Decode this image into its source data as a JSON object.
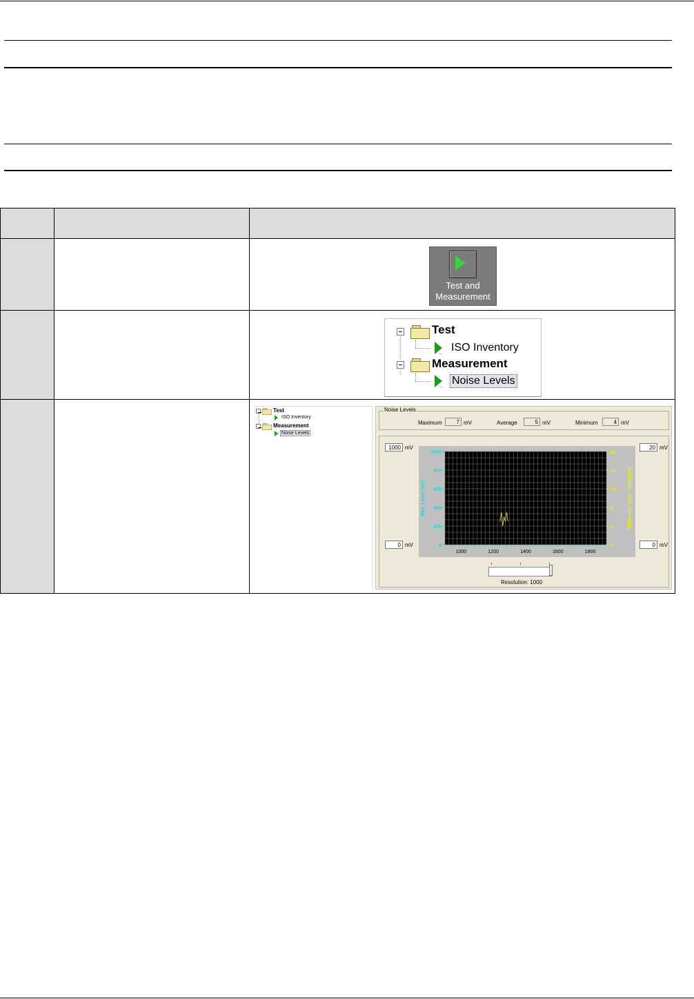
{
  "table": {
    "rows": [
      {
        "step": "",
        "action": "",
        "image": "test-and-measurement-button"
      },
      {
        "step": "",
        "action": "",
        "image": "tree-view"
      },
      {
        "step": "",
        "action": "",
        "image": "noise-levels-screen"
      }
    ]
  },
  "button": {
    "label_line1": "Test and",
    "label_line2": "Measurement",
    "icon": "green-play-icon"
  },
  "tree": {
    "test": "Test",
    "iso_inventory": "ISO Inventory",
    "measurement": "Measurement",
    "noise_levels": "Noise Levels"
  },
  "noise_panel": {
    "group_title": "Noise Levels",
    "maximum_label": "Maximum",
    "maximum_value": "7",
    "average_label": "Average",
    "average_value": "5",
    "minimum_label": "Minimum",
    "minimum_value": "4",
    "unit": "mV",
    "left_top_value": "1000",
    "left_bottom_value": "0",
    "right_top_value": "20",
    "right_bottom_value": "0",
    "resolution_label": "Resolution: 1000"
  },
  "chart_data": {
    "type": "line",
    "x_ticks": [
      "1000",
      "1200",
      "1400",
      "1600",
      "1800"
    ],
    "y_left_ticks": [
      "0",
      "200",
      "400",
      "600",
      "800",
      "1000"
    ],
    "y_right_ticks": [
      "0",
      "4",
      "8",
      "12",
      "16",
      "20"
    ],
    "ylabel_left": "Max. Level [mV]",
    "ylabel_right": "Difference [Max - Min] [mV]",
    "xlim": [
      900,
      1900
    ],
    "ylim_left": [
      0,
      1000
    ],
    "ylim_right": [
      0,
      20
    ],
    "grid": true,
    "colors": {
      "plot_bg": "#000000",
      "grid": "#808080",
      "left_axis": "#00e5e5",
      "right_axis": "#f0f000",
      "frame": "#c0c0c0"
    },
    "series": [
      {
        "values": [
          [
            1240,
            5
          ],
          [
            1250,
            7
          ],
          [
            1258,
            4
          ],
          [
            1266,
            6
          ],
          [
            1274,
            5
          ],
          [
            1282,
            7
          ],
          [
            1290,
            5
          ]
        ]
      }
    ]
  }
}
